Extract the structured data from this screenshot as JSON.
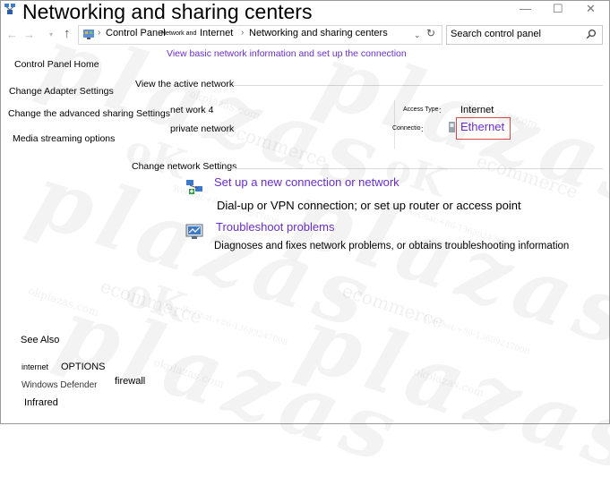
{
  "window": {
    "title": "Networking and sharing centers",
    "controls": {
      "minimize": "—",
      "maximize": "☐",
      "close": "✕"
    }
  },
  "address_bar": {
    "crumb_1": "Control Panel",
    "crumb_2_small": "Network and",
    "crumb_2": "Internet",
    "crumb_3": "Networking and sharing centers",
    "separator": "›"
  },
  "search": {
    "placeholder": "Search control panel"
  },
  "sidebar": {
    "items": [
      {
        "label": "Control Panel Home"
      },
      {
        "label": "Change Adapter Settings"
      },
      {
        "label": "Change the advanced sharing Settings"
      },
      {
        "label": "Media streaming options"
      }
    ]
  },
  "main": {
    "heading": "View basic network information and set up the connection",
    "active_network_label": "View the active network",
    "network_name": "net work 4",
    "network_type": "private network",
    "access_type_label": "Access Type",
    "access_type_value": "Internet",
    "connections_label": "Connectio",
    "connection_link": "Ethernet",
    "colon": ":",
    "change_settings_label": "Change network Settings",
    "tasks": [
      {
        "title": "Set up a new connection or network",
        "description": "Dial-up or VPN connection; or set up router or access point"
      },
      {
        "title": "Troubleshoot problems",
        "description": "Diagnoses and fixes network problems, or obtains troubleshooting information"
      }
    ]
  },
  "see_also": {
    "heading": "See Also",
    "internet_small": "internet",
    "internet_options": "OPTIONS",
    "windows_defender": "Windows Defender",
    "firewall": "firewall",
    "infrared": "Infrared"
  },
  "watermark": {
    "brand": "plazas",
    "ok": "oK",
    "site": "okplazas.com",
    "ecommerce": "ecommerce",
    "wechat": "WeChat:+86-13689247008"
  }
}
